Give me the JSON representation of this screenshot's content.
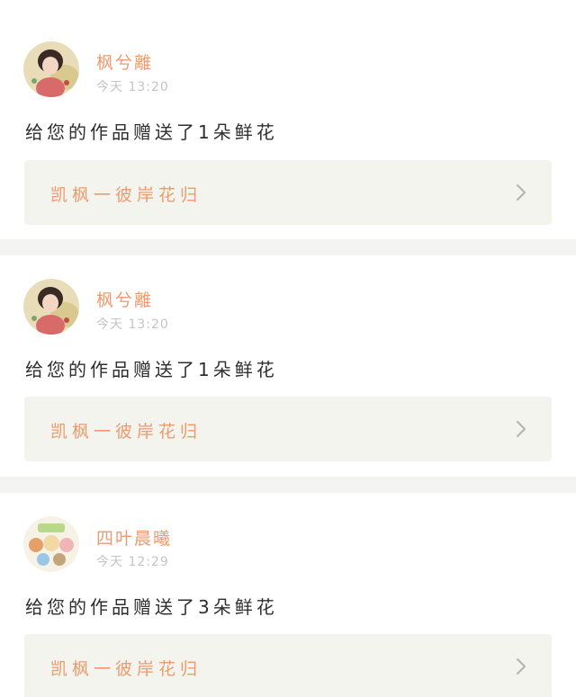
{
  "notifications": [
    {
      "user": "枫兮離",
      "time": "今天 13:20",
      "message": "给您的作品赠送了1朵鲜花",
      "work_title": "凯枫一彼岸花归",
      "avatar_icon": "woman-portrait-avatar"
    },
    {
      "user": "枫兮離",
      "time": "今天 13:20",
      "message": "给您的作品赠送了1朵鲜花",
      "work_title": "凯枫一彼岸花归",
      "avatar_icon": "woman-portrait-avatar"
    },
    {
      "user": "四叶晨曦",
      "time": "今天 12:29",
      "message": "给您的作品赠送了3朵鲜花",
      "work_title": "凯枫一彼岸花归",
      "avatar_icon": "cartoon-characters-avatar"
    }
  ],
  "colors": {
    "accent_pink": "#e8799e",
    "username_orange": "#ee9a6e",
    "work_bar_bg": "#f4f4ef",
    "divider": "#f3f3f1"
  }
}
